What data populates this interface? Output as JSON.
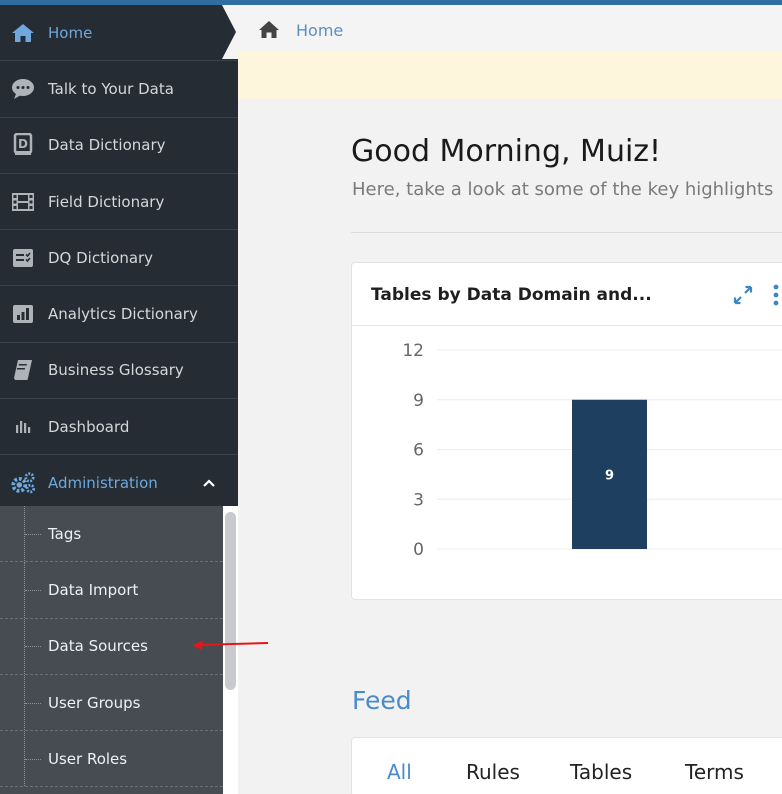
{
  "sidebar": {
    "items": [
      {
        "label": "Home",
        "icon": "home-icon"
      },
      {
        "label": "Talk to Your Data",
        "icon": "chat-icon"
      },
      {
        "label": "Data Dictionary",
        "icon": "book-d-icon"
      },
      {
        "label": "Field Dictionary",
        "icon": "film-icon"
      },
      {
        "label": "DQ Dictionary",
        "icon": "checklist-icon"
      },
      {
        "label": "Analytics Dictionary",
        "icon": "bar-chart-icon"
      },
      {
        "label": "Business Glossary",
        "icon": "glossary-book-icon"
      },
      {
        "label": "Dashboard",
        "icon": "dashboard-icon"
      },
      {
        "label": "Administration",
        "icon": "gears-icon"
      }
    ],
    "subitems": [
      {
        "label": "Tags"
      },
      {
        "label": "Data Import"
      },
      {
        "label": "Data Sources"
      },
      {
        "label": "User Groups"
      },
      {
        "label": "User Roles"
      }
    ]
  },
  "breadcrumb": {
    "label": "Home"
  },
  "main": {
    "greeting": "Good Morning, Muiz!",
    "subtitle": "Here, take a look at some of the key highlights"
  },
  "chart_card": {
    "title": "Tables by Data Domain and..."
  },
  "chart_data": {
    "type": "bar",
    "categories": [
      ""
    ],
    "values": [
      9
    ],
    "data_labels": [
      "9"
    ],
    "ylim": [
      0,
      12
    ],
    "yticks": [
      "0",
      "3",
      "6",
      "9",
      "12"
    ],
    "grid": true,
    "bar_color": "#1e3f5f"
  },
  "feed": {
    "title": "Feed",
    "tabs": [
      "All",
      "Rules",
      "Tables",
      "Terms"
    ]
  },
  "colors": {
    "accent": "#4a8bc9",
    "sidebar_bg": "#262c33",
    "annotation": "#e3161a"
  }
}
